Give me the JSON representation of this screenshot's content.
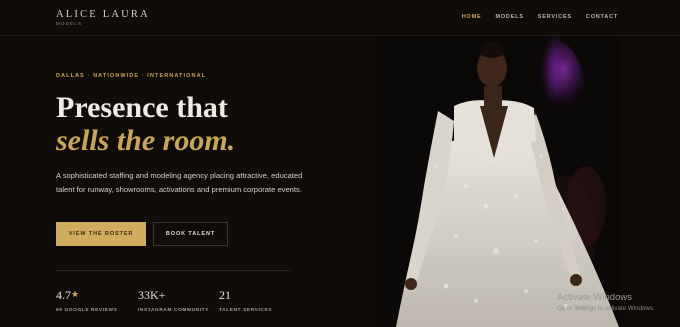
{
  "brand": {
    "name": "ALICE LAURA",
    "sub": "MODELS"
  },
  "nav": [
    {
      "label": "HOME",
      "active": true
    },
    {
      "label": "MODELS",
      "active": false
    },
    {
      "label": "SERVICES",
      "active": false
    },
    {
      "label": "CONTACT",
      "active": false
    }
  ],
  "hero": {
    "eyebrow": "DALLAS · NATIONWIDE · INTERNATIONAL",
    "headline_line1": "Presence that",
    "headline_line2": "sells the room.",
    "description": "A sophisticated staffing and modeling agency placing attractive, educated talent for runway, showrooms, activations and premium corporate events.",
    "primary_button": "VIEW THE ROSTER",
    "secondary_button": "BOOK TALENT"
  },
  "stats": [
    {
      "value": "4.7",
      "label": "69 GOOGLE REVIEWS",
      "icon": "star-icon"
    },
    {
      "value": "33K+",
      "label": "INSTAGRAM COMMUNITY"
    },
    {
      "value": "21",
      "label": "TALENT SERVICES"
    }
  ],
  "watermark": {
    "title": "Activate Windows",
    "subtitle": "Go to Settings to activate Windows."
  },
  "colors": {
    "background": "#0f0c0a",
    "accent": "#c9a45a",
    "button": "#d1ac5e",
    "text": "#f1ece3"
  }
}
